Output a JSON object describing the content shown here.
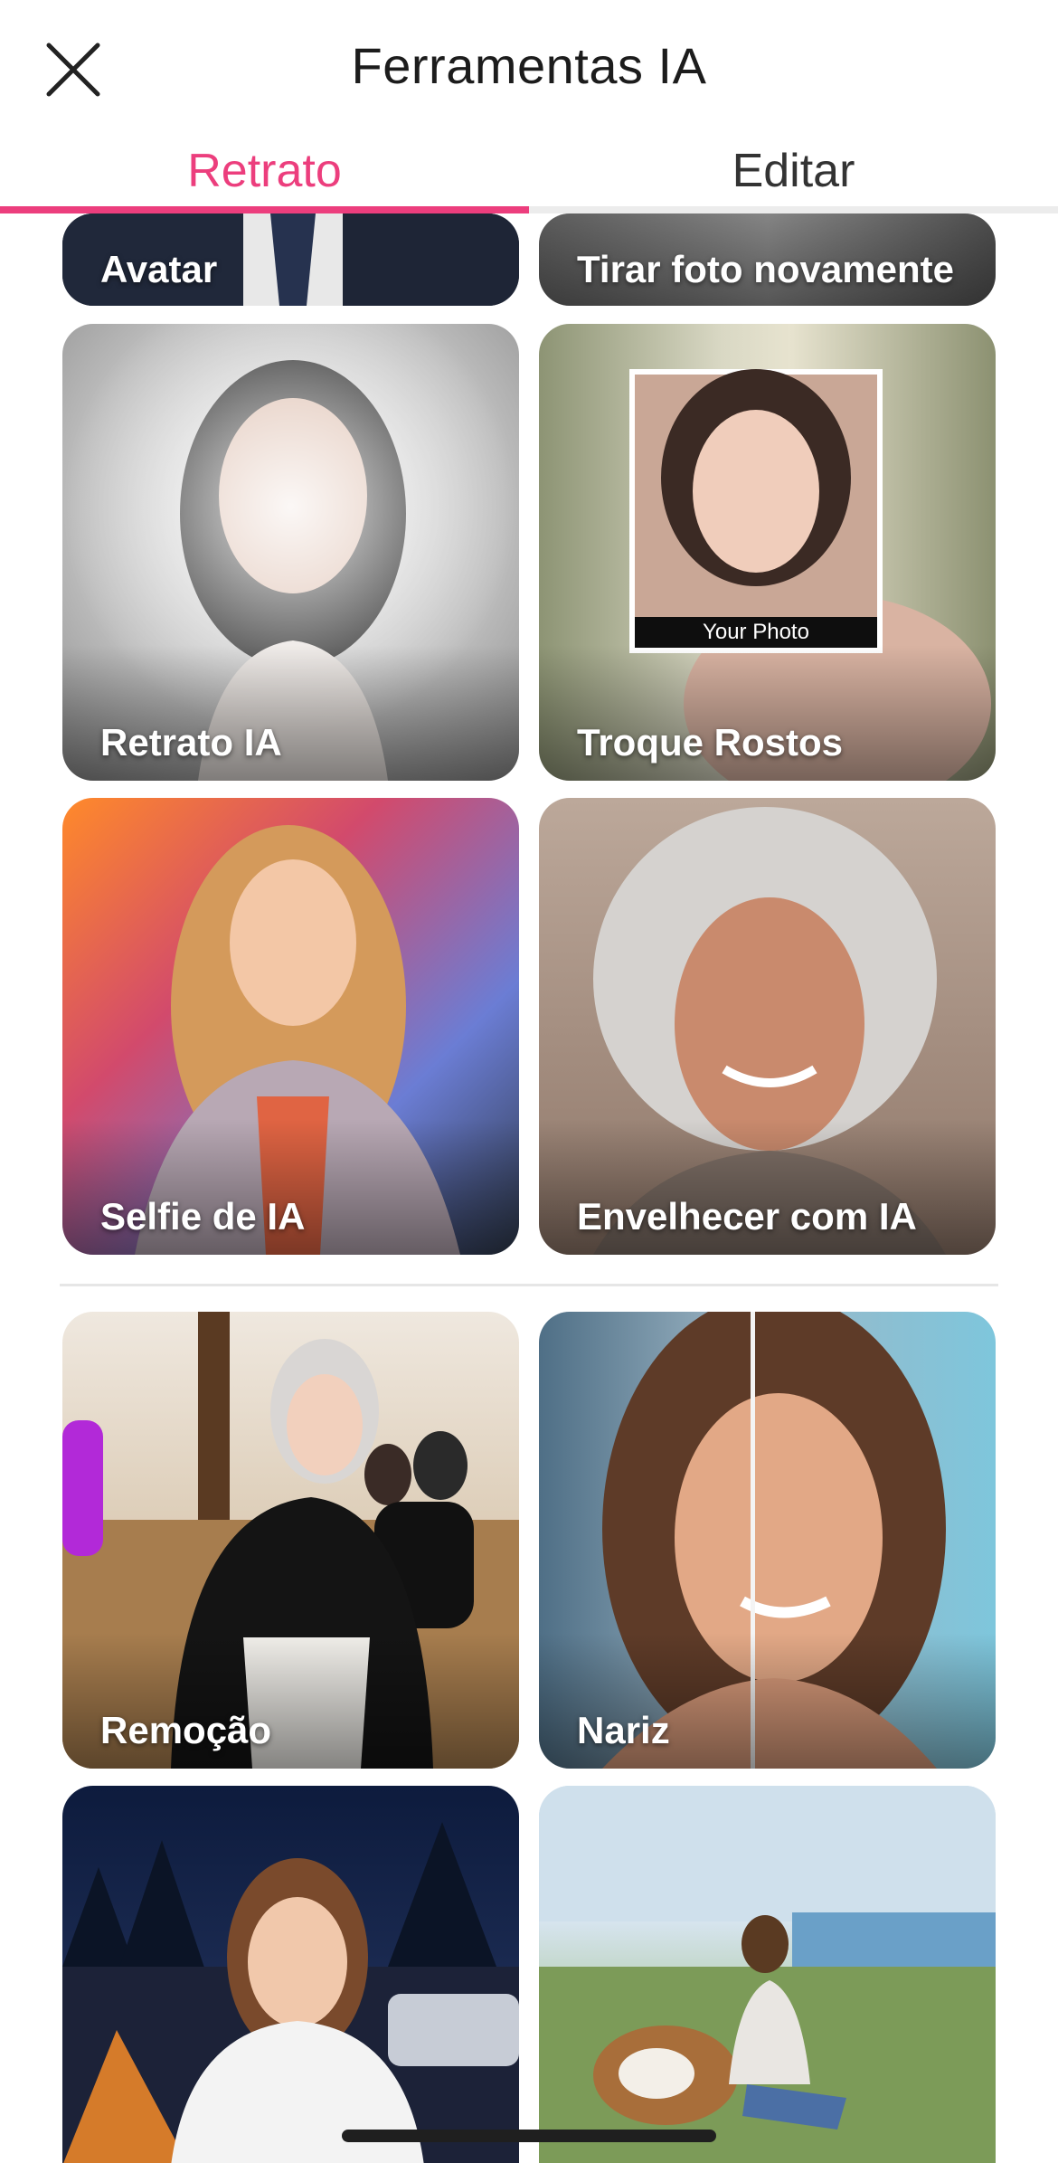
{
  "header": {
    "title": "Ferramentas IA"
  },
  "tabs": [
    {
      "label": "Retrato",
      "active": true
    },
    {
      "label": "Editar",
      "active": false
    }
  ],
  "colors": {
    "accent": "#ec3e7d"
  },
  "tools_group_1": [
    {
      "label": "Avatar"
    },
    {
      "label": "Tirar foto novamente"
    },
    {
      "label": "Retrato IA"
    },
    {
      "label": "Troque Rostos",
      "overlay_caption": "Your Photo"
    },
    {
      "label": "Selfie de IA"
    },
    {
      "label": "Envelhecer com IA"
    }
  ],
  "tools_group_2": [
    {
      "label": "Remoção"
    },
    {
      "label": "Nariz"
    },
    {
      "label": ""
    },
    {
      "label": ""
    }
  ]
}
